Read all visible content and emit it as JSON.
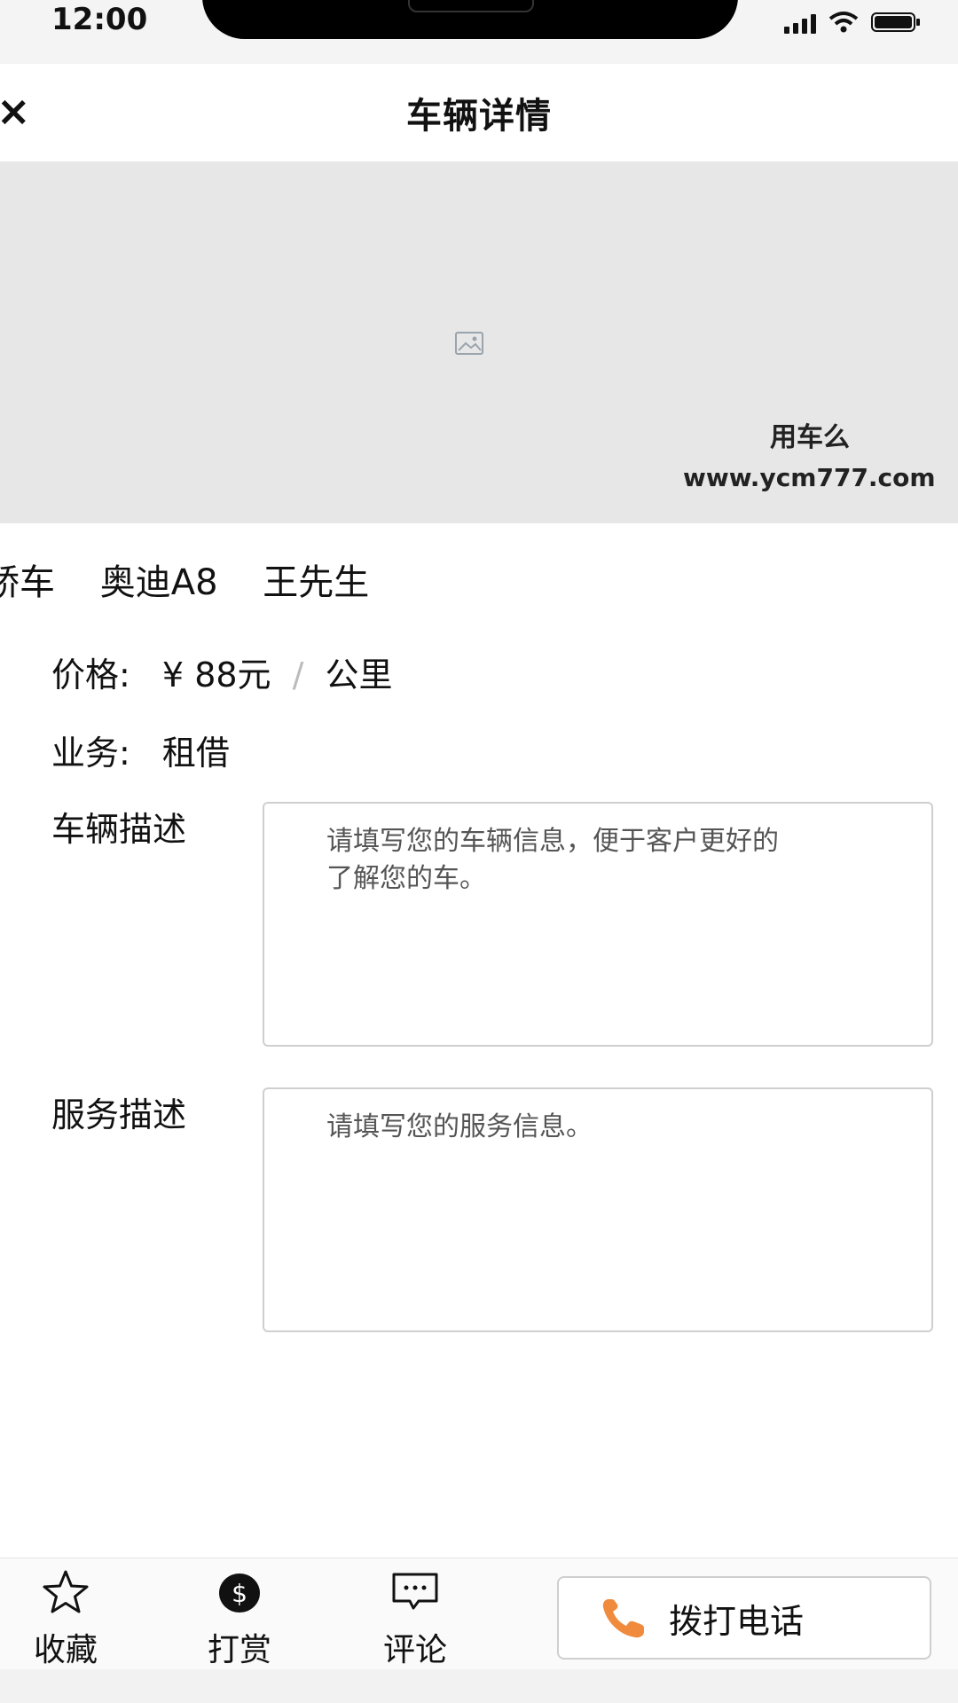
{
  "status_bar": {
    "time": "12:00"
  },
  "nav": {
    "back_icon": "close-x",
    "title": "车辆详情"
  },
  "hero": {
    "image_icon": "image-placeholder-icon",
    "watermark_line1": "用车么",
    "watermark_line2": "www.ycm777.com"
  },
  "car": {
    "type": "轿车",
    "model": "奥迪A8",
    "owner": "王先生"
  },
  "price": {
    "label": "价格:",
    "currency": "¥",
    "amount": "88元",
    "separator": "/",
    "unit": "公里"
  },
  "business": {
    "label": "业务:",
    "value": "租借"
  },
  "vehicle_desc": {
    "label": "车辆描述",
    "placeholder": "请填写您的车辆信息，便于客户更好的了解您的车。"
  },
  "service_desc": {
    "label": "服务描述",
    "placeholder": "请填写您的服务信息。"
  },
  "bottom_bar": {
    "favorite": {
      "label": "收藏",
      "icon": "star-icon"
    },
    "tip": {
      "label": "打赏",
      "icon": "dollar-icon"
    },
    "comment": {
      "label": "评论",
      "icon": "comment-icon"
    },
    "call": {
      "label": "拨打电话",
      "icon": "phone-icon",
      "icon_color": "#f08a3c"
    }
  }
}
